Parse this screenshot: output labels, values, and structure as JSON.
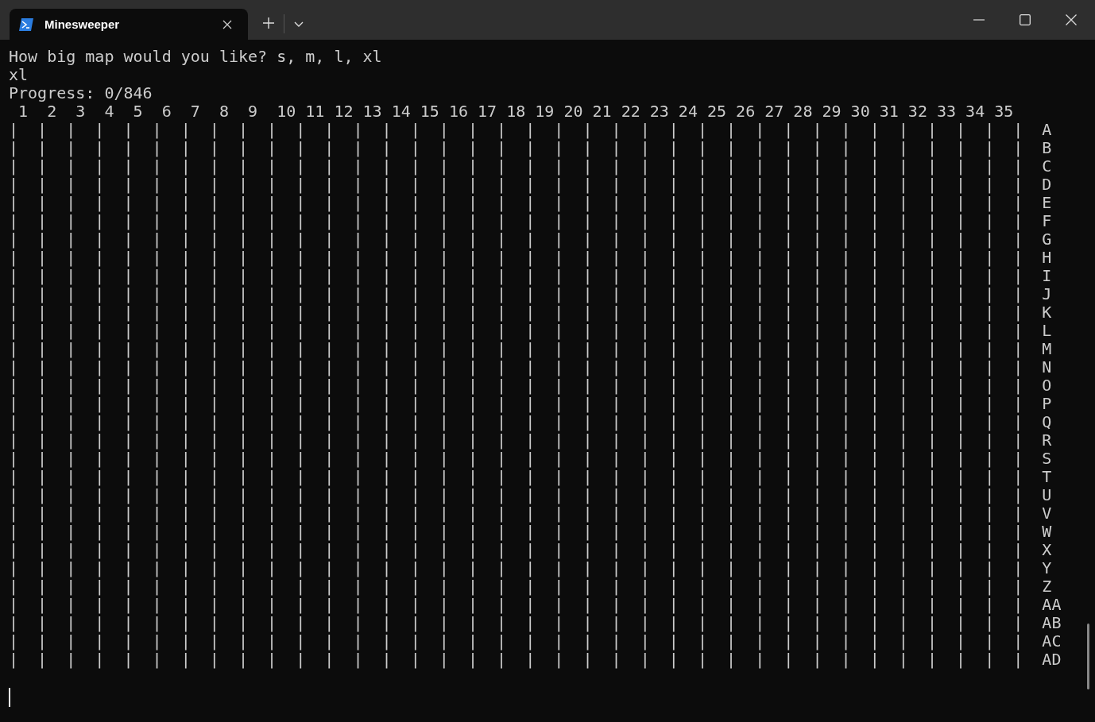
{
  "tab": {
    "title": "Minesweeper",
    "selected": true
  },
  "terminal": {
    "lines": [
      "How big map would you like? s, m, l, xl",
      "xl",
      "Progress: 0/846"
    ],
    "column_header": " 1  2  3  4  5  6  7  8  9  10 11 12 13 14 15 16 17 18 19 20 21 22 23 24 25 26 27 28 29 30 31 32 33 34 35",
    "rows": [
      {
        "cells": "|  |  |  |  |  |  |  |  |  |  |  |  |  |  |  |  |  |  |  |  |  |  |  |  |  |  |  |  |  |  |  |  |  |  |  |",
        "label": "A"
      },
      {
        "cells": "|  |  |  |  |  |  |  |  |  |  |  |  |  |  |  |  |  |  |  |  |  |  |  |  |  |  |  |  |  |  |  |  |  |  |  |",
        "label": "B"
      },
      {
        "cells": "|  |  |  |  |  |  |  |  |  |  |  |  |  |  |  |  |  |  |  |  |  |  |  |  |  |  |  |  |  |  |  |  |  |  |  |",
        "label": "C"
      },
      {
        "cells": "|  |  |  |  |  |  |  |  |  |  |  |  |  |  |  |  |  |  |  |  |  |  |  |  |  |  |  |  |  |  |  |  |  |  |  |",
        "label": "D"
      },
      {
        "cells": "|  |  |  |  |  |  |  |  |  |  |  |  |  |  |  |  |  |  |  |  |  |  |  |  |  |  |  |  |  |  |  |  |  |  |  |",
        "label": "E"
      },
      {
        "cells": "|  |  |  |  |  |  |  |  |  |  |  |  |  |  |  |  |  |  |  |  |  |  |  |  |  |  |  |  |  |  |  |  |  |  |  |",
        "label": "F"
      },
      {
        "cells": "|  |  |  |  |  |  |  |  |  |  |  |  |  |  |  |  |  |  |  |  |  |  |  |  |  |  |  |  |  |  |  |  |  |  |  |",
        "label": "G"
      },
      {
        "cells": "|  |  |  |  |  |  |  |  |  |  |  |  |  |  |  |  |  |  |  |  |  |  |  |  |  |  |  |  |  |  |  |  |  |  |  |",
        "label": "H"
      },
      {
        "cells": "|  |  |  |  |  |  |  |  |  |  |  |  |  |  |  |  |  |  |  |  |  |  |  |  |  |  |  |  |  |  |  |  |  |  |  |",
        "label": "I"
      },
      {
        "cells": "|  |  |  |  |  |  |  |  |  |  |  |  |  |  |  |  |  |  |  |  |  |  |  |  |  |  |  |  |  |  |  |  |  |  |  |",
        "label": "J"
      },
      {
        "cells": "|  |  |  |  |  |  |  |  |  |  |  |  |  |  |  |  |  |  |  |  |  |  |  |  |  |  |  |  |  |  |  |  |  |  |  |",
        "label": "K"
      },
      {
        "cells": "|  |  |  |  |  |  |  |  |  |  |  |  |  |  |  |  |  |  |  |  |  |  |  |  |  |  |  |  |  |  |  |  |  |  |  |",
        "label": "L"
      },
      {
        "cells": "|  |  |  |  |  |  |  |  |  |  |  |  |  |  |  |  |  |  |  |  |  |  |  |  |  |  |  |  |  |  |  |  |  |  |  |",
        "label": "M"
      },
      {
        "cells": "|  |  |  |  |  |  |  |  |  |  |  |  |  |  |  |  |  |  |  |  |  |  |  |  |  |  |  |  |  |  |  |  |  |  |  |",
        "label": "N"
      },
      {
        "cells": "|  |  |  |  |  |  |  |  |  |  |  |  |  |  |  |  |  |  |  |  |  |  |  |  |  |  |  |  |  |  |  |  |  |  |  |",
        "label": "O"
      },
      {
        "cells": "|  |  |  |  |  |  |  |  |  |  |  |  |  |  |  |  |  |  |  |  |  |  |  |  |  |  |  |  |  |  |  |  |  |  |  |",
        "label": "P"
      },
      {
        "cells": "|  |  |  |  |  |  |  |  |  |  |  |  |  |  |  |  |  |  |  |  |  |  |  |  |  |  |  |  |  |  |  |  |  |  |  |",
        "label": "Q"
      },
      {
        "cells": "|  |  |  |  |  |  |  |  |  |  |  |  |  |  |  |  |  |  |  |  |  |  |  |  |  |  |  |  |  |  |  |  |  |  |  |",
        "label": "R"
      },
      {
        "cells": "|  |  |  |  |  |  |  |  |  |  |  |  |  |  |  |  |  |  |  |  |  |  |  |  |  |  |  |  |  |  |  |  |  |  |  |",
        "label": "S"
      },
      {
        "cells": "|  |  |  |  |  |  |  |  |  |  |  |  |  |  |  |  |  |  |  |  |  |  |  |  |  |  |  |  |  |  |  |  |  |  |  |",
        "label": "T"
      },
      {
        "cells": "|  |  |  |  |  |  |  |  |  |  |  |  |  |  |  |  |  |  |  |  |  |  |  |  |  |  |  |  |  |  |  |  |  |  |  |",
        "label": "U"
      },
      {
        "cells": "|  |  |  |  |  |  |  |  |  |  |  |  |  |  |  |  |  |  |  |  |  |  |  |  |  |  |  |  |  |  |  |  |  |  |  |",
        "label": "V"
      },
      {
        "cells": "|  |  |  |  |  |  |  |  |  |  |  |  |  |  |  |  |  |  |  |  |  |  |  |  |  |  |  |  |  |  |  |  |  |  |  |",
        "label": "W"
      },
      {
        "cells": "|  |  |  |  |  |  |  |  |  |  |  |  |  |  |  |  |  |  |  |  |  |  |  |  |  |  |  |  |  |  |  |  |  |  |  |",
        "label": "X"
      },
      {
        "cells": "|  |  |  |  |  |  |  |  |  |  |  |  |  |  |  |  |  |  |  |  |  |  |  |  |  |  |  |  |  |  |  |  |  |  |  |",
        "label": "Y"
      },
      {
        "cells": "|  |  |  |  |  |  |  |  |  |  |  |  |  |  |  |  |  |  |  |  |  |  |  |  |  |  |  |  |  |  |  |  |  |  |  |",
        "label": "Z"
      },
      {
        "cells": "|  |  |  |  |  |  |  |  |  |  |  |  |  |  |  |  |  |  |  |  |  |  |  |  |  |  |  |  |  |  |  |  |  |  |  |",
        "label": "AA"
      },
      {
        "cells": "|  |  |  |  |  |  |  |  |  |  |  |  |  |  |  |  |  |  |  |  |  |  |  |  |  |  |  |  |  |  |  |  |  |  |  |",
        "label": "AB"
      },
      {
        "cells": "|  |  |  |  |  |  |  |  |  |  |  |  |  |  |  |  |  |  |  |  |  |  |  |  |  |  |  |  |  |  |  |  |  |  |  |",
        "label": "AC"
      },
      {
        "cells": "|  |  |  |  |  |  |  |  |  |  |  |  |  |  |  |  |  |  |  |  |  |  |  |  |  |  |  |  |  |  |  |  |  |  |  |",
        "label": "AD"
      }
    ]
  }
}
